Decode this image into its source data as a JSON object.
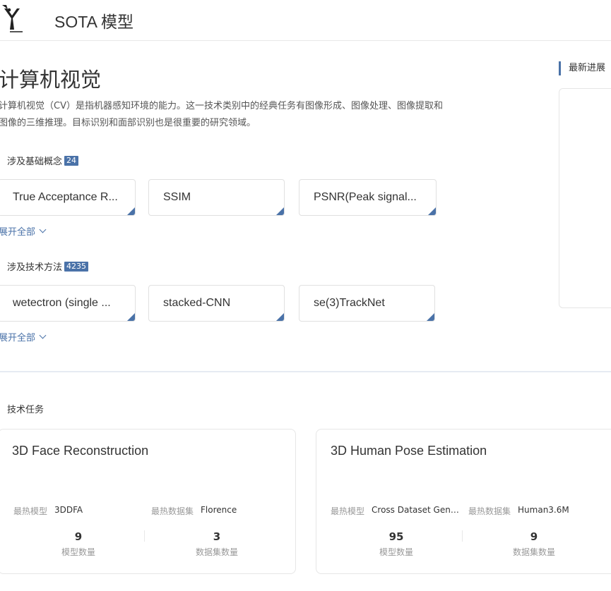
{
  "header": {
    "logo_icon": "synced-logo-icon",
    "title": "SOTA 模型"
  },
  "main": {
    "title": "计算机视觉",
    "description": "计算机视觉（CV）是指机器感知环境的能力。这一技术类别中的经典任务有图像形成、图像处理、图像提取和图像的三维推理。目标识别和面部识别也是很重要的研究领域。",
    "concepts": {
      "label": "涉及基础概念",
      "count": "24",
      "items": [
        "True Acceptance R...",
        "SSIM",
        "PSNR(Peak signal..."
      ],
      "expand": "展开全部"
    },
    "methods": {
      "label": "涉及技术方法",
      "count": "4235",
      "items": [
        "wetectron (single ...",
        "stacked-CNN",
        "se(3)TrackNet"
      ],
      "expand": "展开全部"
    }
  },
  "sidebar": {
    "latest_title": "最新进展"
  },
  "tasks": {
    "label": "技术任务",
    "cards": [
      {
        "title": "3D Face Reconstruction",
        "top_model_label": "最热模型",
        "top_model": "3DDFA",
        "top_dataset_label": "最热数据集",
        "top_dataset": "Florence",
        "model_count": "9",
        "model_count_label": "模型数量",
        "dataset_count": "3",
        "dataset_count_label": "数据集数量"
      },
      {
        "title": "3D Human Pose Estimation",
        "top_model_label": "最热模型",
        "top_model": "Cross Dataset Gener...",
        "top_dataset_label": "最热数据集",
        "top_dataset": "Human3.6M",
        "model_count": "95",
        "model_count_label": "模型数量",
        "dataset_count": "9",
        "dataset_count_label": "数据集数量"
      }
    ]
  },
  "colors": {
    "accent": "#4a72a8",
    "text": "#333333",
    "muted": "#999999"
  }
}
